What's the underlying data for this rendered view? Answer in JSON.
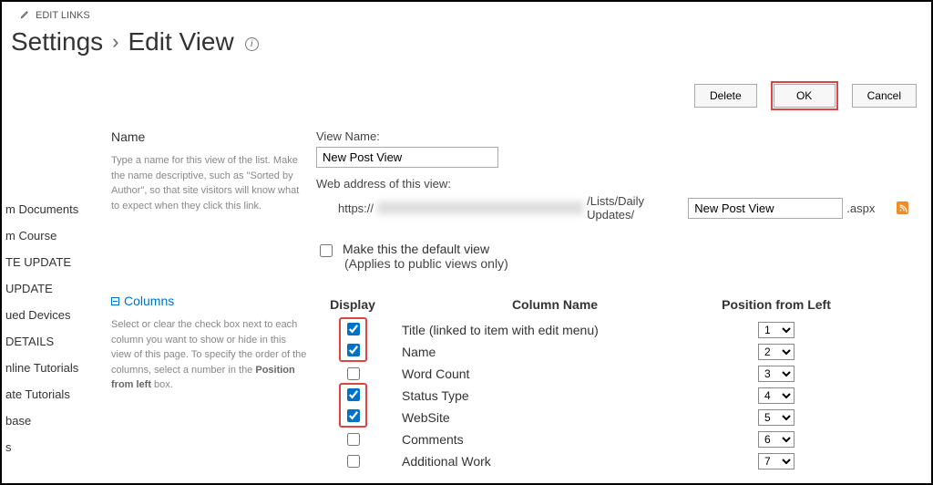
{
  "edit_links_label": "EDIT LINKS",
  "breadcrumb": {
    "settings": "Settings",
    "edit_view": "Edit View"
  },
  "actions": {
    "delete": "Delete",
    "ok": "OK",
    "cancel": "Cancel"
  },
  "sidebar": {
    "items": [
      "m Documents",
      "m Course",
      "TE UPDATE",
      "UPDATE",
      "ued Devices",
      "DETAILS",
      "nline Tutorials",
      "ate Tutorials",
      "base",
      "s"
    ]
  },
  "name_section": {
    "title": "Name",
    "desc_part1": "Type a name for this view of the list. Make the name descriptive, such as \"Sorted by Author\", so that site visitors will know what to expect when they click this link.",
    "view_name_label": "View Name:",
    "view_name_value": "New Post View",
    "web_address_label": "Web address of this view:",
    "url_prefix": "https://",
    "url_mid": "/Lists/Daily Updates/",
    "url_input_value": "New Post View",
    "url_suffix": ".aspx",
    "default_view_label": "Make this the default view",
    "default_view_sub": "(Applies to public views only)"
  },
  "columns_section": {
    "title": "Columns",
    "desc_prefix": "Select or clear the check box next to each column you want to show or hide in this view of this page. To specify the order of the columns, select a number in the ",
    "desc_bold": "Position from left",
    "desc_suffix": " box.",
    "header": {
      "display": "Display",
      "name": "Column Name",
      "pos": "Position from Left"
    },
    "rows": [
      {
        "name": "Title (linked to item with edit menu)",
        "checked": true,
        "highlight": "top",
        "pos": "1"
      },
      {
        "name": "Name",
        "checked": true,
        "highlight": "bot",
        "pos": "2"
      },
      {
        "name": "Word Count",
        "checked": false,
        "highlight": "none",
        "pos": "3"
      },
      {
        "name": "Status Type",
        "checked": true,
        "highlight": "top",
        "pos": "4"
      },
      {
        "name": "WebSite",
        "checked": true,
        "highlight": "bot",
        "pos": "5"
      },
      {
        "name": "Comments",
        "checked": false,
        "highlight": "none",
        "pos": "6"
      },
      {
        "name": "Additional Work",
        "checked": false,
        "highlight": "none",
        "pos": "7"
      }
    ],
    "select_options": [
      "1",
      "2",
      "3",
      "4",
      "5",
      "6",
      "7"
    ]
  }
}
